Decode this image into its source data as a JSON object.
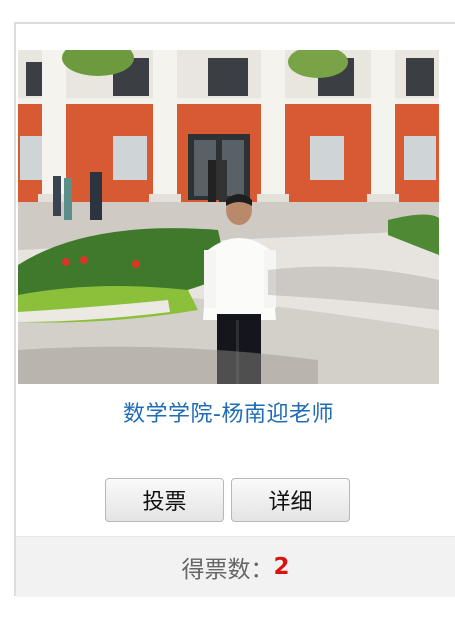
{
  "candidate": {
    "name": "数学学院-杨南迎老师",
    "photo_alt": "杨南迎老师照片"
  },
  "actions": {
    "vote_label": "投票",
    "detail_label": "详细"
  },
  "votes": {
    "label": "得票数：",
    "count": "2"
  }
}
